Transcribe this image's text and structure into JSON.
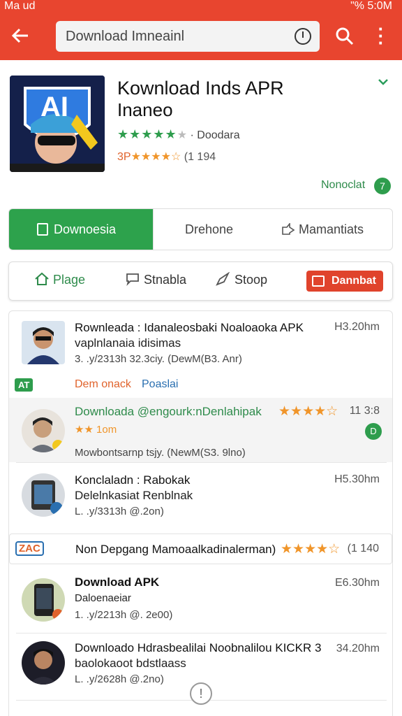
{
  "status": {
    "left": "Ma ud",
    "right": "\"% 5:0M"
  },
  "search": {
    "value": "Download Imneainl"
  },
  "header": {
    "title": "Kownload Inds APR",
    "subtitle": "Inaneo",
    "stars_green": "★★★★★",
    "stars_gray": "★",
    "rating_label": "· Doodara",
    "rating2_prefix": "3P",
    "stars_orange": "★★★★☆",
    "rating2_count": "(1 194",
    "notice": "Nonoclat",
    "notice_badge": "7"
  },
  "segments": {
    "active": "Downoesia",
    "middle": "Drehone",
    "right": "Mamantiats"
  },
  "tools": {
    "t1": "Plage",
    "t2": "Stnabla",
    "t3": "Stoop",
    "button": "Dannbat"
  },
  "list": {
    "r1": {
      "title": "Rownleada : Idanaleosbaki Noaloaoka APK",
      "subtitle": "vaplnlanaia   idisimas",
      "meta": "3. .y/2313h   32.3ciy. (DewM(B3. Anr)",
      "time": "H3.20hm"
    },
    "r2": {
      "tag": "AT",
      "label": "Dem onack",
      "label2": "Poaslai"
    },
    "r3": {
      "title": "Downloada @engourk:nDenlahipak",
      "stars": "★★★★☆",
      "count": "11 3:8",
      "sub": "★★ 1om",
      "meta": "Mowbontsarnp tsjy. (NewM(S3. 9lno)",
      "badge": "D"
    },
    "r4": {
      "title": "Konclaladn : Rabokak",
      "subtitle": "Delelnkasiat Renblnak",
      "meta": "L. .y/3313h   @.2on)",
      "time": "H5.30hm"
    },
    "r5": {
      "tag": "ZAC",
      "title": "Non Depgang Mamoaalkadinalerman)",
      "stars": "★★★★☆",
      "count": "(1 140"
    },
    "r6": {
      "title": "Download  APK",
      "subtitle": "Daloenaeiar",
      "meta": "1. .y/2213h   @. 2e00)",
      "time": "E6.30hm"
    },
    "r7": {
      "title": "Downloado Hdrasbealilai Noobnalilou KICKR 3",
      "subtitle": "baolokaoot  bdstlaass",
      "meta": "L. .y/2628h   @.2no)",
      "time": "34.20hm"
    }
  }
}
